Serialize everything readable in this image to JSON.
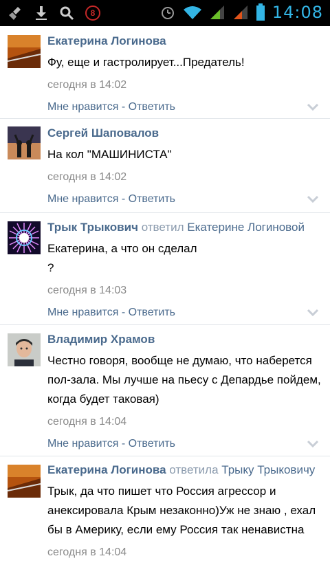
{
  "status_bar": {
    "time": "14:08",
    "notification_count": "8",
    "icons": [
      "broom-icon",
      "download-icon",
      "search-icon",
      "badge-icon",
      "alarm-icon",
      "wifi-icon",
      "signal-icon",
      "signal-icon",
      "battery-icon"
    ]
  },
  "actions": {
    "like": "Мне нравится",
    "separator": " - ",
    "reply": "Ответить"
  },
  "comments": [
    {
      "author": "Екатерина Логинова",
      "reply_word": "",
      "reply_to": "",
      "text": "Фу, еще и гастролирует...Предатель!",
      "time": "сегодня в 14:02"
    },
    {
      "author": "Сергей Шаповалов",
      "reply_word": "",
      "reply_to": "",
      "text": "На кол \"МАШИНИСТА\"",
      "time": "сегодня в 14:02"
    },
    {
      "author": "Трык Трыкович",
      "reply_word": "ответил",
      "reply_to": "Екатерине Логиновой",
      "text": "Екатерина, а что он сделал\n?",
      "time": "сегодня в 14:03"
    },
    {
      "author": "Владимир Храмов",
      "reply_word": "",
      "reply_to": "",
      "text": "Честно говоря, вообще не думаю, что наберется пол-зала. Мы лучше на пьесу с Депардье пойдем, когда будет таковая)",
      "time": "сегодня в 14:04"
    },
    {
      "author": "Екатерина Логинова",
      "reply_word": "ответила",
      "reply_to": "Трыку Трыковичу",
      "text": "Трык, да что пишет что Россия агрессор и анексировала Крым незаконно)Уж не знаю , ехал бы в Америку, если ему Россия так ненавистна",
      "time": "сегодня в 14:04"
    }
  ]
}
